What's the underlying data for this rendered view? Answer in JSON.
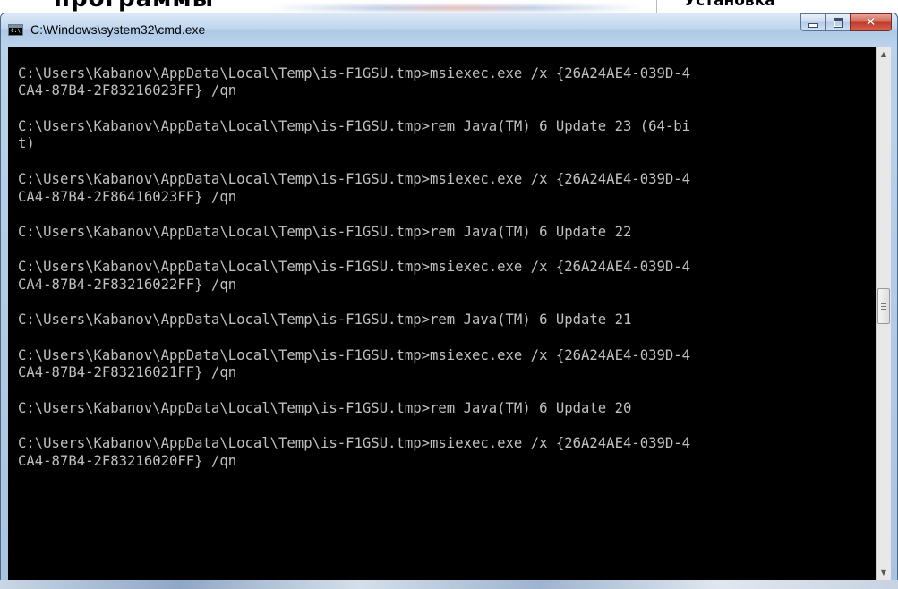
{
  "background": {
    "left_heading": "программы",
    "right_heading": "Установка"
  },
  "window": {
    "title": "C:\\Windows\\system32\\cmd.exe",
    "icon": "cmd-icon",
    "icon_label": "C:\\",
    "buttons": {
      "minimize": "minimize-icon",
      "maximize": "maximize-icon",
      "close": "close-icon"
    }
  },
  "console": {
    "lines": [
      "",
      "C:\\Users\\Kabanov\\AppData\\Local\\Temp\\is-F1GSU.tmp>msiexec.exe /x {26A24AE4-039D-4",
      "CA4-87B4-2F83216023FF} /qn",
      "",
      "C:\\Users\\Kabanov\\AppData\\Local\\Temp\\is-F1GSU.tmp>rem Java(TM) 6 Update 23 (64-bi",
      "t)",
      "",
      "C:\\Users\\Kabanov\\AppData\\Local\\Temp\\is-F1GSU.tmp>msiexec.exe /x {26A24AE4-039D-4",
      "CA4-87B4-2F86416023FF} /qn",
      "",
      "C:\\Users\\Kabanov\\AppData\\Local\\Temp\\is-F1GSU.tmp>rem Java(TM) 6 Update 22",
      "",
      "C:\\Users\\Kabanov\\AppData\\Local\\Temp\\is-F1GSU.tmp>msiexec.exe /x {26A24AE4-039D-4",
      "CA4-87B4-2F83216022FF} /qn",
      "",
      "C:\\Users\\Kabanov\\AppData\\Local\\Temp\\is-F1GSU.tmp>rem Java(TM) 6 Update 21",
      "",
      "C:\\Users\\Kabanov\\AppData\\Local\\Temp\\is-F1GSU.tmp>msiexec.exe /x {26A24AE4-039D-4",
      "CA4-87B4-2F83216021FF} /qn",
      "",
      "C:\\Users\\Kabanov\\AppData\\Local\\Temp\\is-F1GSU.tmp>rem Java(TM) 6 Update 20",
      "",
      "C:\\Users\\Kabanov\\AppData\\Local\\Temp\\is-F1GSU.tmp>msiexec.exe /x {26A24AE4-039D-4",
      "CA4-87B4-2F83216020FF} /qn",
      ""
    ]
  },
  "scrollbar": {
    "up_icon": "scroll-up-arrow-icon",
    "down_icon": "scroll-down-arrow-icon",
    "thumb_icon": "scroll-grip-icon"
  },
  "colors": {
    "console_bg": "#000000",
    "console_fg": "#c0c0c0",
    "titlebar": "#c0d6ee",
    "close_button": "#c0392b"
  }
}
